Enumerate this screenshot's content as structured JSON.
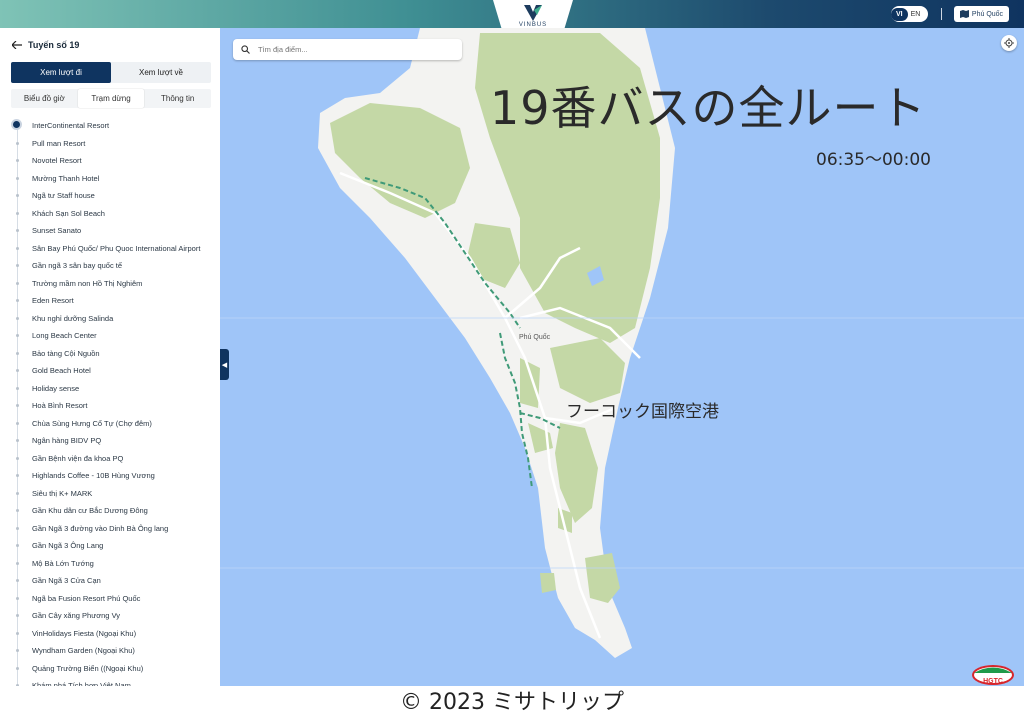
{
  "header": {
    "logo_text": "VINBUS",
    "lang_vi": "VI",
    "lang_en": "EN",
    "region": "Phú Quốc"
  },
  "sidebar": {
    "route_title": "Tuyến số 19",
    "dir_tabs": [
      "Xem lượt đi",
      "Xem lượt về"
    ],
    "sub_tabs": [
      "Biểu đồ giờ",
      "Trạm dừng",
      "Thông tin"
    ],
    "stops": [
      "InterContinental Resort",
      "Pull man Resort",
      "Novotel Resort",
      "Mường Thanh Hotel",
      "Ngã tư Staff house",
      "Khách Sạn Sol Beach",
      "Sunset Sanato",
      "Sân Bay Phú Quốc/ Phu Quoc International Airport",
      "Gần ngã 3 sân bay quốc tế",
      "Trường mầm non Hồ Thị Nghiêm",
      "Eden Resort",
      "Khu nghỉ dưỡng Salinda",
      "Long Beach Center",
      "Bảo tàng Cội Nguồn",
      "Gold Beach Hotel",
      "Holiday sense",
      "Hoà Bình Resort",
      "Chùa Sùng Hưng Cổ Tự (Chợ đêm)",
      "Ngân hàng BIDV PQ",
      "Gần Bệnh viện đa khoa PQ",
      "Highlands Coffee - 10B Hùng Vương",
      "Siêu thị K+ MARK",
      "Gần Khu dân cư Bắc Dương Đông",
      "Gần Ngã 3 đường vào Dinh Bà Ông lang",
      "Gần Ngã 3 Ông Lang",
      "Mộ Bà Lớn Tướng",
      "Gần Ngã 3 Cửa Cạn",
      "Ngã ba Fusion Resort Phú Quốc",
      "Gần Cây xăng Phương Vy",
      "VinHolidays Fiesta (Ngoại Khu)",
      "Wyndham Garden (Ngoại Khu)",
      "Quảng Trường Biển ((Ngoại Khu)",
      "Khám phá Tích hợp Việt Nam"
    ]
  },
  "map": {
    "search_placeholder": "Tìm địa điểm...",
    "town_label": "Phú Quốc",
    "overlay_title": "19番バスの全ルート",
    "overlay_hours": "06:35〜00:00",
    "overlay_airport": "フーコック国際空港",
    "badge_text": "HGTC"
  },
  "footer": {
    "copyright": "© 2023 ミサトリップ"
  },
  "colors": {
    "primary": "#0f3460",
    "water": "#9fc5f8",
    "land": "#f3f3f1",
    "forest": "#c4d8a6",
    "route": "#3f9a78"
  }
}
